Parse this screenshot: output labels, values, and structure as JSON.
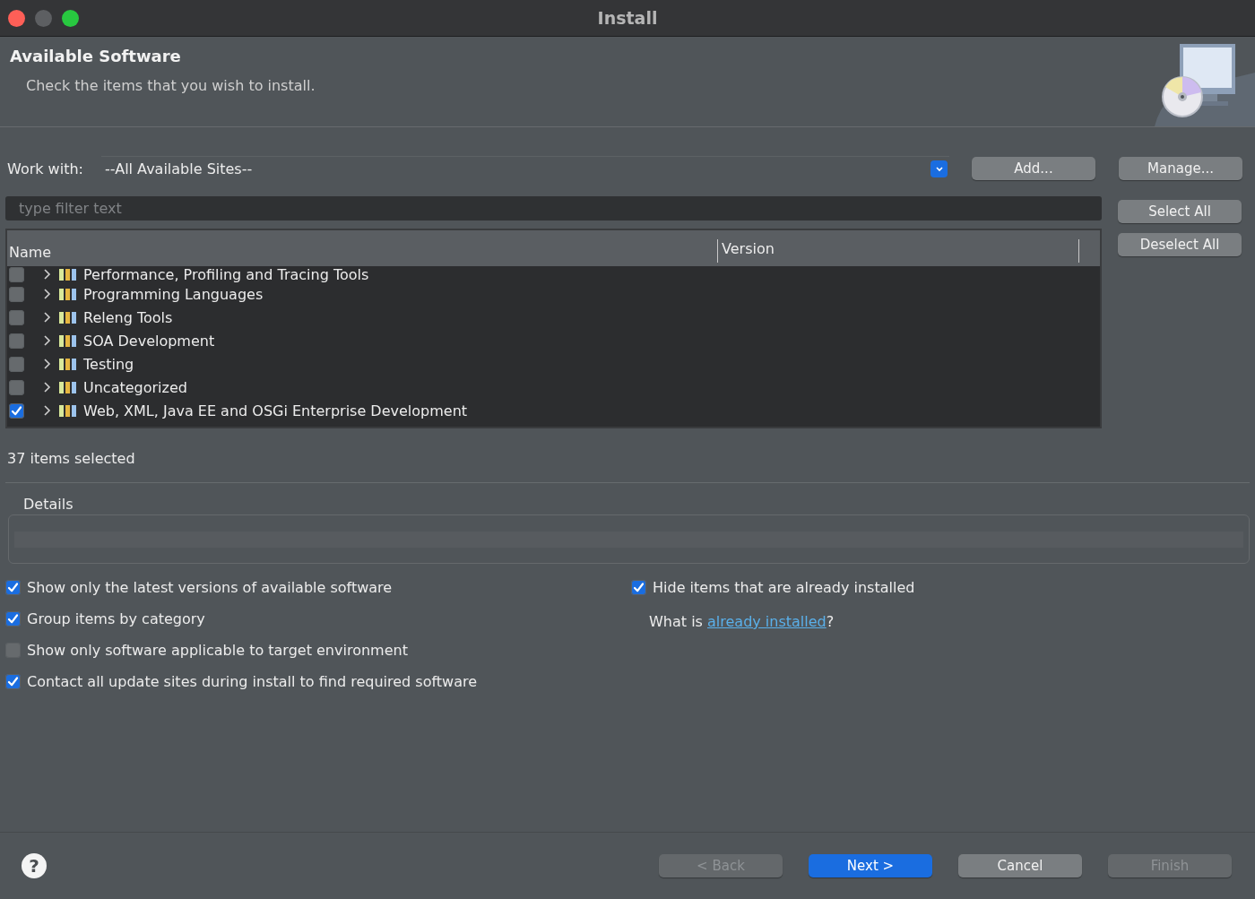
{
  "window": {
    "title": "Install"
  },
  "header": {
    "title": "Available Software",
    "subtitle": "Check the items that you wish to install."
  },
  "work_with": {
    "label": "Work with:",
    "value": "--All Available Sites--",
    "buttons": [
      "Add...",
      "Manage..."
    ]
  },
  "filter": {
    "placeholder": "type filter text"
  },
  "tree": {
    "columns": [
      "Name",
      "Version"
    ],
    "rows": [
      {
        "name": "Performance, Profiling and Tracing Tools",
        "checked": false,
        "expanded": false
      },
      {
        "name": "Programming Languages",
        "checked": false,
        "expanded": false
      },
      {
        "name": "Releng Tools",
        "checked": false,
        "expanded": false
      },
      {
        "name": "SOA Development",
        "checked": false,
        "expanded": false
      },
      {
        "name": "Testing",
        "checked": false,
        "expanded": false
      },
      {
        "name": "Uncategorized",
        "checked": false,
        "expanded": false
      },
      {
        "name": "Web, XML, Java EE and OSGi Enterprise Development",
        "checked": true,
        "expanded": false
      }
    ]
  },
  "tree_buttons": [
    "Select All",
    "Deselect All"
  ],
  "status": "37 items selected",
  "details": {
    "label": "Details"
  },
  "options_left": [
    {
      "label": "Show only the latest versions of available software",
      "checked": true
    },
    {
      "label": "Group items by category",
      "checked": true
    },
    {
      "label": "Show only software applicable to target environment",
      "checked": false
    },
    {
      "label": "Contact all update sites during install to find required software",
      "checked": true
    }
  ],
  "options_right": [
    {
      "label": "Hide items that are already installed",
      "checked": true
    }
  ],
  "help_line": {
    "before": "What is ",
    "link": "already installed",
    "after": "?"
  },
  "footer": {
    "help": "?",
    "buttons": [
      {
        "label": "< Back",
        "disabled": true,
        "primary": false
      },
      {
        "label": "Next >",
        "disabled": false,
        "primary": true
      },
      {
        "label": "Cancel",
        "disabled": false,
        "primary": false
      },
      {
        "label": "Finish",
        "disabled": true,
        "primary": false
      }
    ]
  }
}
